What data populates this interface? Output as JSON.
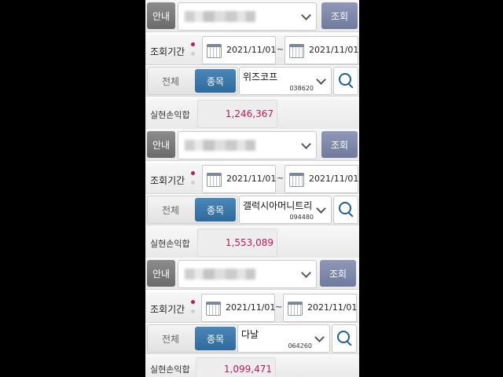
{
  "labels": {
    "guide": "안내",
    "query": "조회",
    "period": "조회기간",
    "tilde": "~",
    "all": "전체",
    "item": "종목",
    "realized_pl": "실현손익합"
  },
  "panels": [
    {
      "from": "2021/11/01",
      "to": "2021/11/01",
      "stock_name": "위즈코프",
      "stock_code": "038620",
      "realized_pl": "1,246,367"
    },
    {
      "from": "2021/11/01",
      "to": "2021/11/01",
      "stock_name": "갤럭시아머니트리",
      "stock_code": "094480",
      "realized_pl": "1,553,089"
    },
    {
      "from": "2021/11/01",
      "to": "2021/11/01",
      "stock_name": "다날",
      "stock_code": "064260",
      "realized_pl": "1,099,471"
    }
  ],
  "colors": {
    "accent_pink": "#c2185b",
    "selected_segment": "#2f6a9d",
    "query_button": "#6f7a9e"
  },
  "icons": {
    "calendar": "calendar-icon",
    "search": "search-icon",
    "dropdown": "chevron-down-icon"
  }
}
